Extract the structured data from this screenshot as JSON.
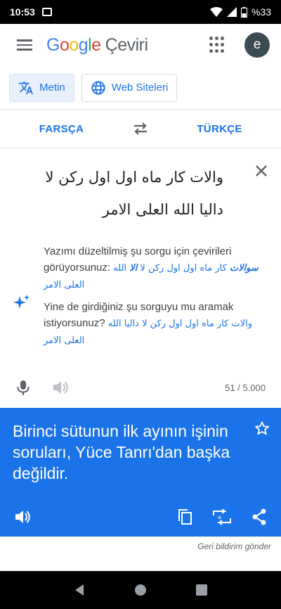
{
  "status": {
    "time": "10:53",
    "battery": "%33"
  },
  "app": {
    "brand_google": [
      "G",
      "o",
      "o",
      "g",
      "l",
      "e"
    ],
    "product": "Çeviri",
    "avatar_letter": "e"
  },
  "modes": [
    {
      "label": "Metin",
      "active": true
    },
    {
      "label": "Web Siteleri",
      "active": false
    }
  ],
  "languages": {
    "source": "FARSÇA",
    "target": "TÜRKÇE"
  },
  "source": {
    "text": "والات کار ماه اول اول رکن لا داليا الله العلى الامر",
    "char_count": "51 / 5.000"
  },
  "suggestions": {
    "corrected_prefix": "Yazımı düzeltilmiş şu sorgu için çevirileri görüyorsunuz:",
    "corrected_bold1": "سوالات",
    "corrected_mid": "کار ماه اول اول رکن لا",
    "corrected_bold2": "الا",
    "corrected_end": "الله العلى الامر",
    "original_prefix": "Yine de girdiğiniz şu sorguyu mu aramak istiyorsunuz?",
    "original_query1": "والات کار ماه اول اول رکن لا داليا",
    "original_query2": "الله العلى الامر"
  },
  "translation": {
    "text": "Birinci sütunun ilk ayının işinin soruları, Yüce Tanrı'dan başka değildir."
  },
  "feedback_label": "Geri bildirim gönder",
  "colors": {
    "accent": "#1a73e8",
    "active_mode_bg": "#e8f0fe"
  }
}
